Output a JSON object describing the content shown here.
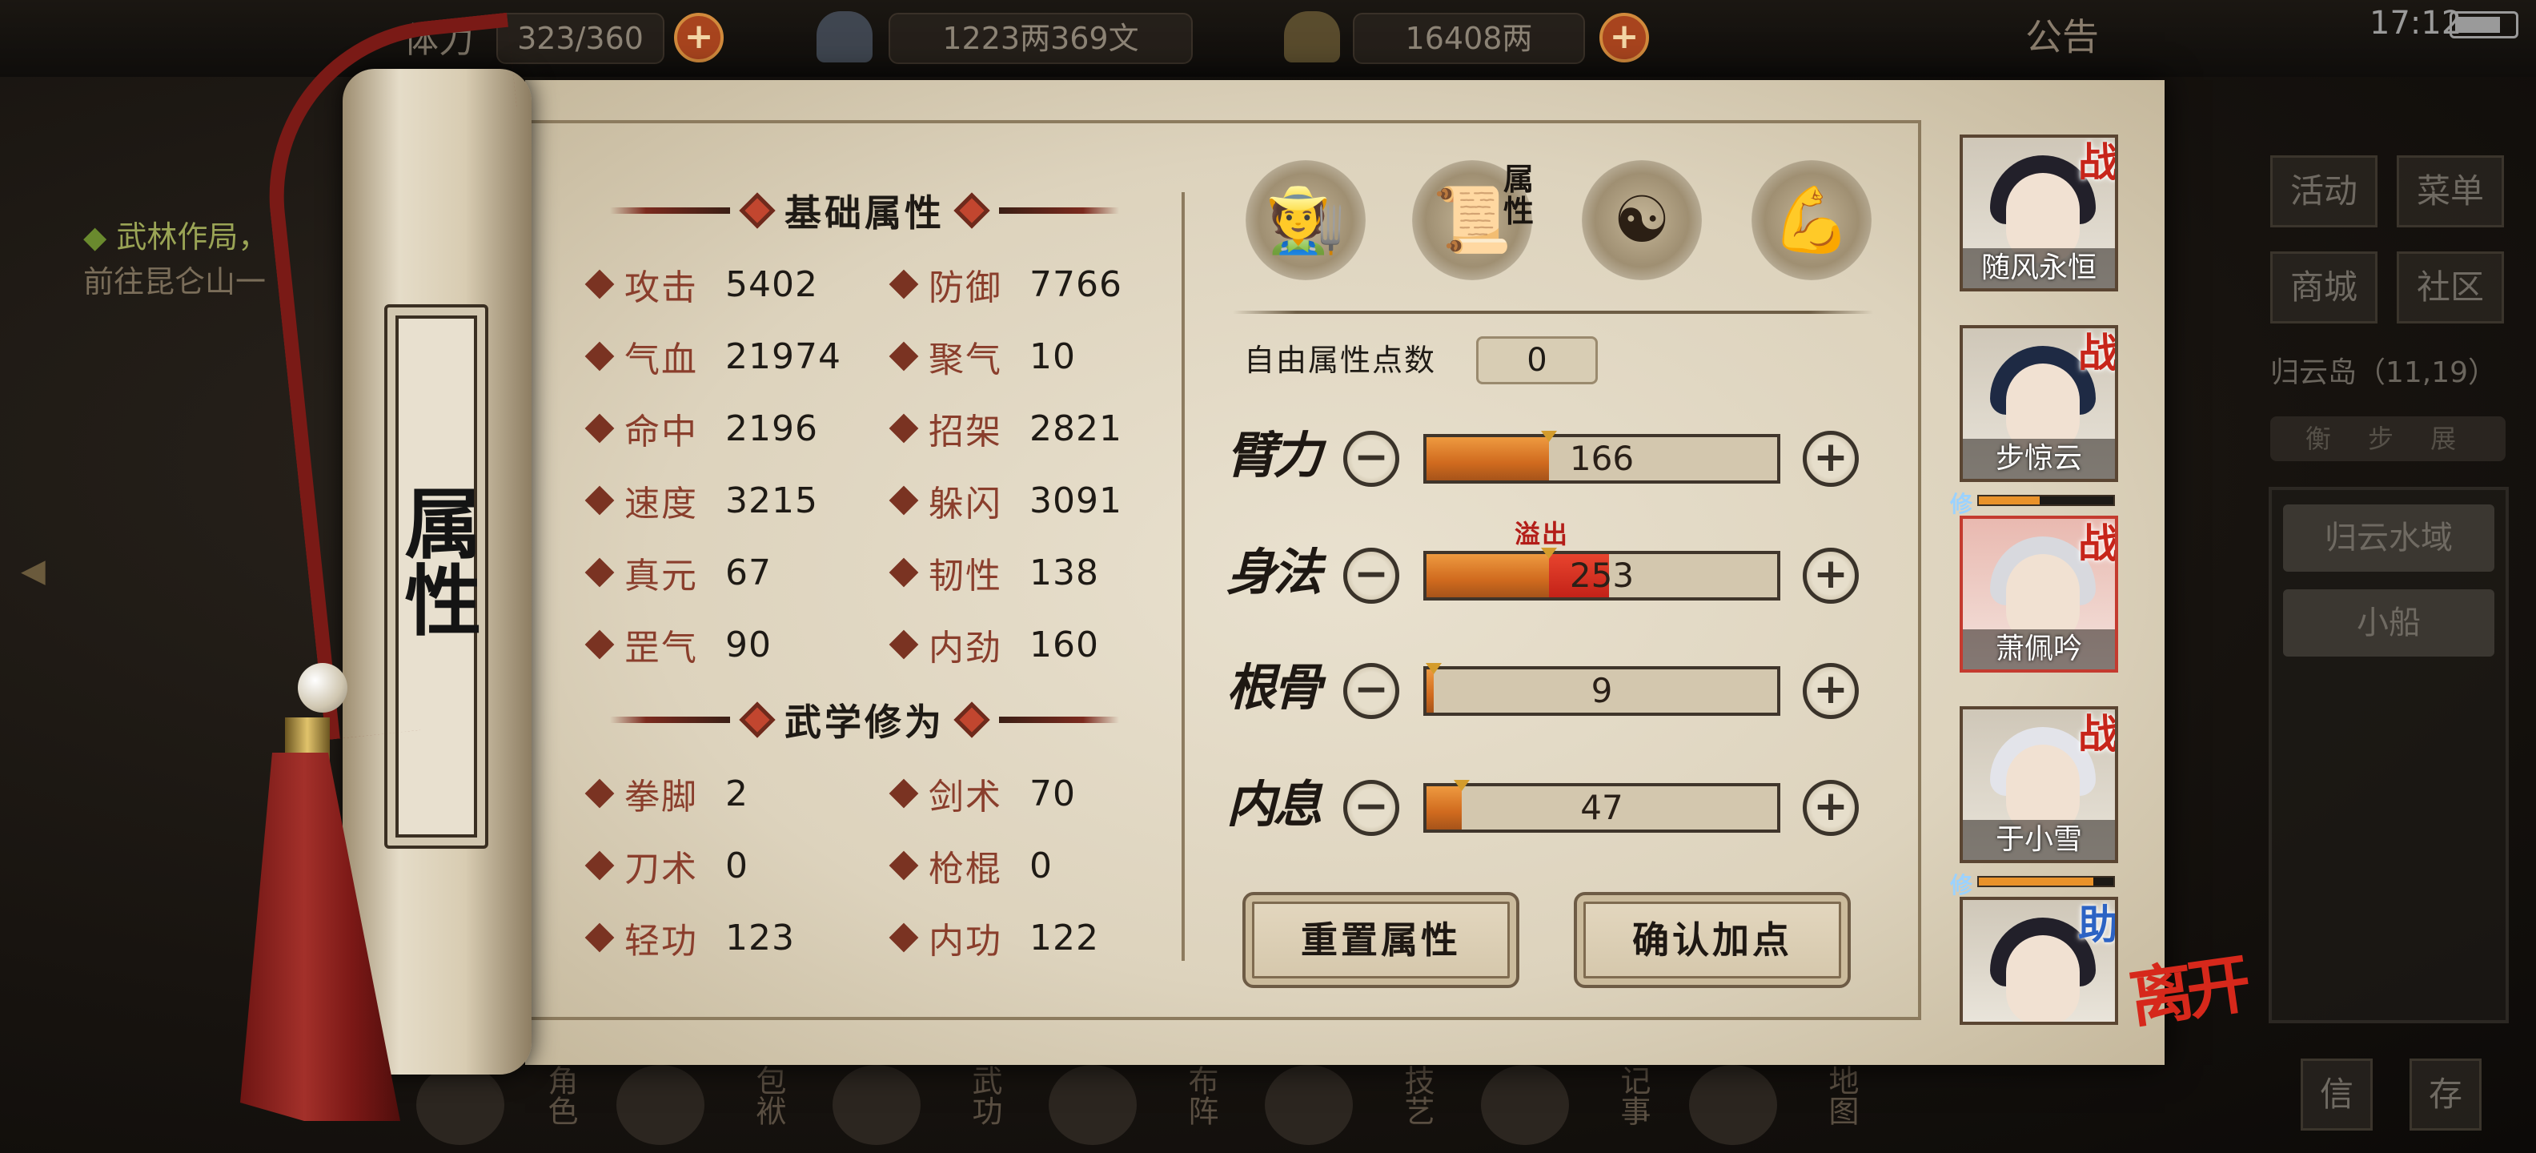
{
  "topbar": {
    "stamina_label": "体力",
    "stamina_value": "323/360",
    "silver": "1223两369文",
    "gold": "16408两",
    "notice": "公告",
    "time": "17:12"
  },
  "quest": {
    "line1": "武林作局，",
    "line2": "前往昆仑山一"
  },
  "side": {
    "buttons": [
      "活动",
      "菜单",
      "商城",
      "社区"
    ],
    "location": "归云岛（11,19）",
    "minimap": "衡 步 展",
    "actions": [
      "归云水域",
      "小船"
    ],
    "bottom_right": [
      "信",
      "存"
    ]
  },
  "bottom_nav": [
    "角色",
    "包袱",
    "武功",
    "布阵",
    "技艺",
    "记事",
    "地图"
  ],
  "scroll_title": "属性",
  "basic": {
    "title": "基础属性",
    "stats": [
      {
        "label": "攻击",
        "value": "5402"
      },
      {
        "label": "防御",
        "value": "7766"
      },
      {
        "label": "气血",
        "value": "21974"
      },
      {
        "label": "聚气",
        "value": "10"
      },
      {
        "label": "命中",
        "value": "2196"
      },
      {
        "label": "招架",
        "value": "2821"
      },
      {
        "label": "速度",
        "value": "3215"
      },
      {
        "label": "躲闪",
        "value": "3091"
      },
      {
        "label": "真元",
        "value": "67"
      },
      {
        "label": "韧性",
        "value": "138"
      },
      {
        "label": "罡气",
        "value": "90"
      },
      {
        "label": "内劲",
        "value": "160"
      }
    ]
  },
  "martial": {
    "title": "武学修为",
    "stats": [
      {
        "label": "拳脚",
        "value": "2"
      },
      {
        "label": "剑术",
        "value": "70"
      },
      {
        "label": "刀术",
        "value": "0"
      },
      {
        "label": "枪棍",
        "value": "0"
      },
      {
        "label": "轻功",
        "value": "123"
      },
      {
        "label": "内功",
        "value": "122"
      }
    ]
  },
  "tabs": {
    "active_label": "属性",
    "icons": [
      "straw-hat-swordsman-icon",
      "attribute-scroll-icon",
      "bagua-icon",
      "meridian-body-icon"
    ]
  },
  "free_points": {
    "label": "自由属性点数",
    "value": "0"
  },
  "attributes": {
    "overflow_label": "溢出",
    "items": [
      {
        "name": "臂力",
        "value": "166",
        "fill": 0.35,
        "overflow": 0
      },
      {
        "name": "身法",
        "value": "253",
        "fill": 0.35,
        "overflow": 0.17
      },
      {
        "name": "根骨",
        "value": "9",
        "fill": 0.02,
        "overflow": 0
      },
      {
        "name": "内息",
        "value": "47",
        "fill": 0.1,
        "overflow": 0
      }
    ],
    "minus_label": "−",
    "plus_label": "+"
  },
  "actions": {
    "reset": "重置属性",
    "confirm": "确认加点"
  },
  "party": [
    {
      "name": "随风永恒",
      "badge": "战"
    },
    {
      "name": "步惊云",
      "badge": "战",
      "cultivation": "修",
      "progress": 0.45
    },
    {
      "name": "萧佩吟",
      "badge": "战"
    },
    {
      "name": "于小雪",
      "badge": "战",
      "cultivation": "修",
      "progress": 0.85
    },
    {
      "name": "",
      "badge": "助"
    }
  ],
  "leave": "离开",
  "colors": {
    "accent_red": "#c7251a",
    "bar_orange": "#d06a1e",
    "overflow_red": "#c32218",
    "paper": "#e2d9c5"
  }
}
